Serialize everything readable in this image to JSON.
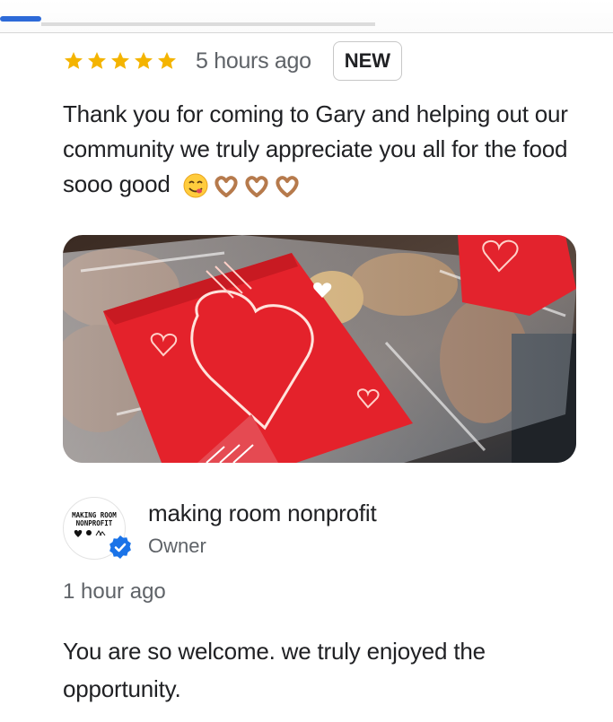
{
  "review": {
    "rating": 5,
    "time": "5 hours ago",
    "badge": "NEW",
    "text": "Thank you for coming to Gary and helping out our community we truly appreciate you all for the food sooo good",
    "emojis": [
      "yum-face-emoji",
      "heart-hands-emoji",
      "heart-hands-emoji",
      "heart-hands-emoji"
    ]
  },
  "photo": {
    "subject": "food-bag-with-heart-napkins-photo"
  },
  "owner_reply": {
    "avatar_text": "MAKING ROOM NONPROFIT",
    "name": "making room nonprofit",
    "role": "Owner",
    "time": "1 hour ago",
    "text": "You are so welcome. we truly enjoyed the opportunity."
  },
  "colors": {
    "star": "#f4b400",
    "verified": "#1a73e8",
    "secondary_text": "#5f6368",
    "primary_text": "#202124"
  }
}
